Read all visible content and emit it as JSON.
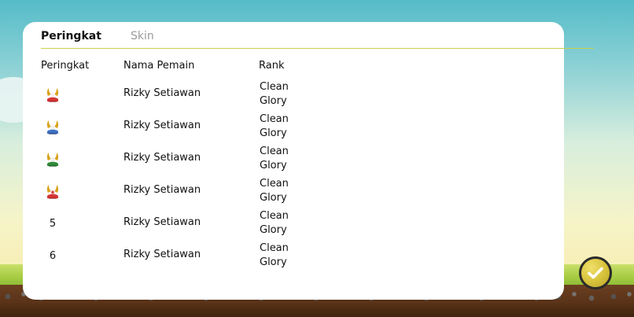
{
  "tabs": {
    "ranking": "Peringkat",
    "skin": "Skin"
  },
  "table": {
    "headers": {
      "rank": "Peringkat",
      "player": "Nama Pemain",
      "tier": "Rank"
    },
    "rows": [
      {
        "rank": "",
        "rank_icon": "red-medal-icon",
        "player": "Rizky Setiawan",
        "tier_line1": "Clean",
        "tier_line2": "Glory"
      },
      {
        "rank": "",
        "rank_icon": "blue-medal-icon",
        "player": "Rizky Setiawan",
        "tier_line1": "Clean",
        "tier_line2": "Glory"
      },
      {
        "rank": "",
        "rank_icon": "green-medal-icon",
        "player": "Rizky Setiawan",
        "tier_line1": "Clean",
        "tier_line2": "Glory"
      },
      {
        "rank": "",
        "rank_icon": "red-star-medal-icon",
        "player": "Rizky Setiawan",
        "tier_line1": "Clean",
        "tier_line2": "Glory"
      },
      {
        "rank": "5",
        "rank_icon": "",
        "player": "Rizky Setiawan",
        "tier_line1": "Clean",
        "tier_line2": "Glory"
      },
      {
        "rank": "6",
        "rank_icon": "",
        "player": "Rizky Setiawan",
        "tier_line1": "Clean",
        "tier_line2": "Glory"
      }
    ]
  },
  "colors": {
    "tab_underline": "#c6d14b",
    "confirm_button": "#d6c13a",
    "confirm_check": "#ffffff"
  },
  "icons": {
    "confirm": "checkmark-icon"
  }
}
